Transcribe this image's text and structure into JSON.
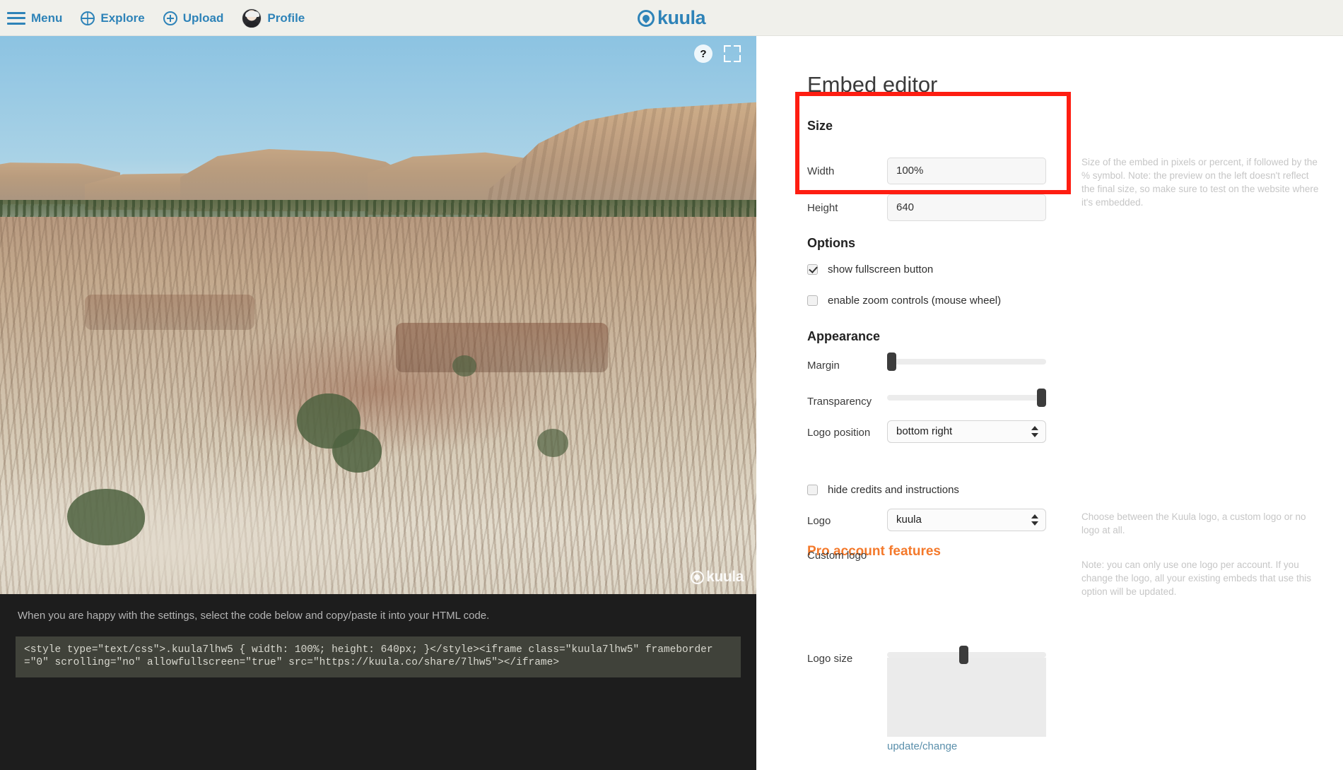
{
  "topbar": {
    "nav": [
      {
        "label": "Menu",
        "icon": "hamburger-icon"
      },
      {
        "label": "Explore",
        "icon": "globe-icon"
      },
      {
        "label": "Upload",
        "icon": "plus-circle-icon"
      },
      {
        "label": "Profile",
        "icon": "avatar-icon"
      }
    ],
    "brand": "kuula",
    "brand_color": "#2e83b8"
  },
  "viewer": {
    "help_glyph": "?",
    "watermark": "kuula"
  },
  "code_panel": {
    "instructions": "When you are happy with the settings, select the code below and copy/paste it into your HTML code.",
    "code": "<style type=\"text/css\">.kuula7lhw5 { width: 100%; height: 640px; }</style><iframe class=\"kuula7lhw5\" frameborder=\"0\" scrolling=\"no\" allowfullscreen=\"true\" src=\"https://kuula.co/share/7lhw5\"></iframe>"
  },
  "editor": {
    "title": "Embed editor",
    "highlight_color": "#fe1d11",
    "size": {
      "heading": "Size",
      "width_label": "Width",
      "width_value": "100%",
      "height_label": "Height",
      "height_value": "640",
      "hint": "Size of the embed in pixels or percent, if followed by the % symbol. Note: the preview on the left doesn't reflect the final size, so make sure to test on the website where it's embedded."
    },
    "options": {
      "heading": "Options",
      "items": [
        {
          "label": "show fullscreen button",
          "checked": true
        },
        {
          "label": "enable zoom controls (mouse wheel)",
          "checked": false
        }
      ]
    },
    "appearance": {
      "heading": "Appearance",
      "margin_label": "Margin",
      "margin_percent": 0,
      "transparency_label": "Transparency",
      "transparency_percent": 100,
      "logo_position_label": "Logo position",
      "logo_position_value": "bottom right"
    },
    "pro": {
      "heading": "Pro account features",
      "heading_color": "#f4792b",
      "hide_credits_label": "hide credits and instructions",
      "hide_credits_checked": false,
      "logo_label": "Logo",
      "logo_value": "kuula",
      "logo_hint": "Choose between the Kuula logo, a custom logo or no logo at all.",
      "custom_logo_label": "Custom logo",
      "custom_logo_hint": "Note: you can only use one logo per account. If you change the logo, all your existing embeds that use this option will be updated.",
      "update_change_label": "update/change",
      "logo_size_label": "Logo size",
      "logo_size_percent": 48
    }
  }
}
